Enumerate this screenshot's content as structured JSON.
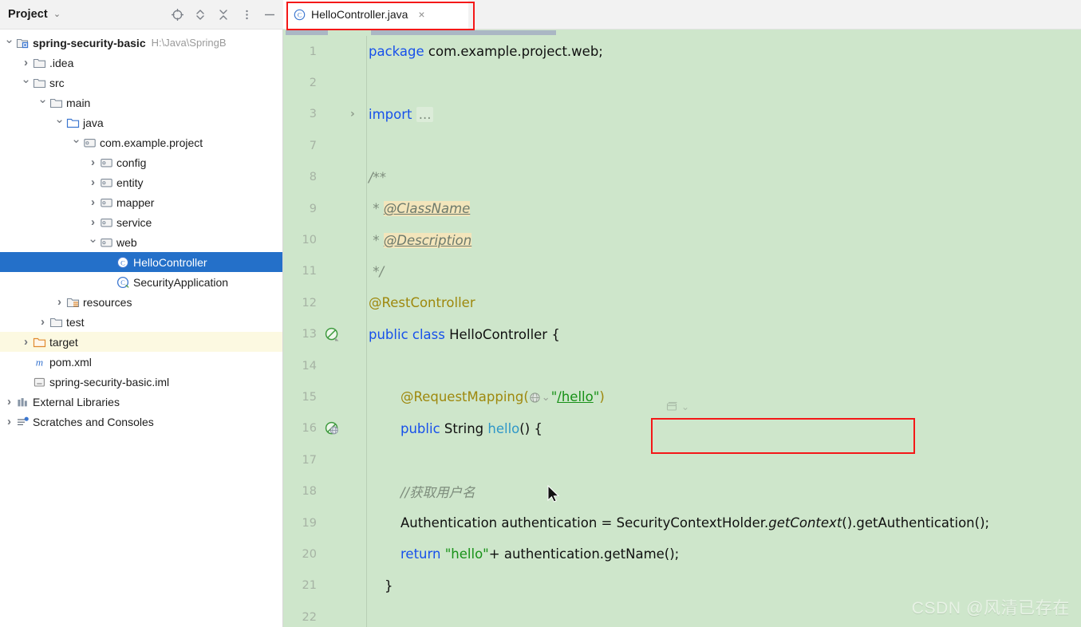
{
  "window": {
    "panel_title": "Project",
    "panel_caret": "⌄"
  },
  "toolbar": {
    "icons": [
      {
        "name": "locate-target-icon",
        "title": "Select Opened File"
      },
      {
        "name": "expand-collapse-icon",
        "title": "Expand / Collapse"
      },
      {
        "name": "collapse-all-icon",
        "title": "Collapse All"
      },
      {
        "name": "more-options-icon",
        "title": "Options"
      },
      {
        "name": "minimize-icon",
        "title": "Hide"
      }
    ]
  },
  "tabs": [
    {
      "label": "HelloController.java",
      "icon": "java-class-icon",
      "close": "×",
      "active": true,
      "annotated": true
    }
  ],
  "annotations": {
    "color": "#f41818",
    "tab_box": "HelloController.java",
    "code_box": "@RequestMapping(\"/hello\")"
  },
  "tree": {
    "items": [
      {
        "depth": 0,
        "arrow": "down",
        "icon": "module-icon",
        "label": "spring-security-basic",
        "bold": true,
        "path": "H:\\Java\\SpringB",
        "state": "normal"
      },
      {
        "depth": 1,
        "arrow": "right",
        "icon": "folder-icon",
        "label": ".idea",
        "bold": false,
        "path": "",
        "state": "normal"
      },
      {
        "depth": 1,
        "arrow": "down",
        "icon": "folder-icon",
        "label": "src",
        "bold": false,
        "path": "",
        "state": "normal"
      },
      {
        "depth": 2,
        "arrow": "down",
        "icon": "folder-icon",
        "label": "main",
        "bold": false,
        "path": "",
        "state": "normal"
      },
      {
        "depth": 3,
        "arrow": "down",
        "icon": "source-root-icon",
        "label": "java",
        "bold": false,
        "path": "",
        "state": "normal"
      },
      {
        "depth": 4,
        "arrow": "down",
        "icon": "package-icon",
        "label": "com.example.project",
        "bold": false,
        "path": "",
        "state": "normal"
      },
      {
        "depth": 5,
        "arrow": "right",
        "icon": "package-icon",
        "label": "config",
        "bold": false,
        "path": "",
        "state": "normal"
      },
      {
        "depth": 5,
        "arrow": "right",
        "icon": "package-icon",
        "label": "entity",
        "bold": false,
        "path": "",
        "state": "normal"
      },
      {
        "depth": 5,
        "arrow": "right",
        "icon": "package-icon",
        "label": "mapper",
        "bold": false,
        "path": "",
        "state": "normal"
      },
      {
        "depth": 5,
        "arrow": "right",
        "icon": "package-icon",
        "label": "service",
        "bold": false,
        "path": "",
        "state": "normal"
      },
      {
        "depth": 5,
        "arrow": "down",
        "icon": "package-icon",
        "label": "web",
        "bold": false,
        "path": "",
        "state": "normal"
      },
      {
        "depth": 6,
        "arrow": "blank",
        "icon": "java-class-icon",
        "label": "HelloController",
        "bold": false,
        "path": "",
        "state": "selected"
      },
      {
        "depth": 6,
        "arrow": "blank",
        "icon": "spring-bean-icon",
        "label": "SecurityApplication",
        "bold": false,
        "path": "",
        "state": "normal"
      },
      {
        "depth": 3,
        "arrow": "right",
        "icon": "resource-root-icon",
        "label": "resources",
        "bold": false,
        "path": "",
        "state": "normal"
      },
      {
        "depth": 2,
        "arrow": "right",
        "icon": "folder-icon",
        "label": "test",
        "bold": false,
        "path": "",
        "state": "normal"
      },
      {
        "depth": 1,
        "arrow": "right",
        "icon": "excluded-folder-icon",
        "label": "target",
        "bold": false,
        "path": "",
        "state": "excluded"
      },
      {
        "depth": 1,
        "arrow": "blank",
        "icon": "maven-icon",
        "label": "pom.xml",
        "bold": false,
        "path": "",
        "state": "normal"
      },
      {
        "depth": 1,
        "arrow": "blank",
        "icon": "iml-icon",
        "label": "spring-security-basic.iml",
        "bold": false,
        "path": "",
        "state": "normal"
      },
      {
        "depth": 0,
        "arrow": "right",
        "icon": "libraries-icon",
        "label": "External Libraries",
        "bold": false,
        "path": "",
        "state": "normal"
      },
      {
        "depth": 0,
        "arrow": "right",
        "icon": "scratches-icon",
        "label": "Scratches and Consoles",
        "bold": false,
        "path": "",
        "state": "normal"
      }
    ]
  },
  "editor": {
    "background": "#cee6cb",
    "gutter_text_color": "#a6b3a4",
    "file": "HelloController.java",
    "lines": [
      {
        "num": "1",
        "gutter_icon": "",
        "fold": "",
        "segments": [
          {
            "t": "package ",
            "c": "kw"
          },
          {
            "t": "com.example.project.web;",
            "c": "plain"
          }
        ]
      },
      {
        "num": "2",
        "gutter_icon": "",
        "fold": "",
        "segments": []
      },
      {
        "num": "3",
        "gutter_icon": "",
        "fold": "right",
        "segments": [
          {
            "t": "import ",
            "c": "kw"
          },
          {
            "t": "...",
            "c": "fold-pl"
          }
        ]
      },
      {
        "num": "7",
        "gutter_icon": "",
        "fold": "",
        "segments": []
      },
      {
        "num": "8",
        "gutter_icon": "",
        "fold": "",
        "segments": [
          {
            "t": "/**",
            "c": "jdoc"
          }
        ]
      },
      {
        "num": "9",
        "gutter_icon": "",
        "fold": "",
        "segments": [
          {
            "t": " * ",
            "c": "jdoc"
          },
          {
            "t": "@ClassName",
            "c": "jdoc-hl"
          }
        ]
      },
      {
        "num": "10",
        "gutter_icon": "",
        "fold": "",
        "segments": [
          {
            "t": " * ",
            "c": "jdoc"
          },
          {
            "t": "@Description",
            "c": "jdoc-hl"
          }
        ]
      },
      {
        "num": "11",
        "gutter_icon": "",
        "fold": "",
        "segments": [
          {
            "t": " */",
            "c": "jdoc"
          }
        ]
      },
      {
        "num": "12",
        "gutter_icon": "",
        "fold": "",
        "segments": [
          {
            "t": "@RestController",
            "c": "anno"
          }
        ]
      },
      {
        "num": "13",
        "gutter_icon": "spring-bean-gutter-icon",
        "fold": "",
        "segments": [
          {
            "t": "public ",
            "c": "kw"
          },
          {
            "t": "class ",
            "c": "kw"
          },
          {
            "t": "HelloController {",
            "c": "plain"
          }
        ]
      },
      {
        "num": "14",
        "gutter_icon": "",
        "fold": "",
        "segments": []
      },
      {
        "num": "15",
        "gutter_icon": "",
        "fold": "",
        "segments": [
          {
            "t": "@RequestMapping",
            "c": "anno"
          },
          {
            "t": "(",
            "c": "anno"
          },
          {
            "t": "GLOBE_CHIP",
            "c": "chip"
          },
          {
            "t": "\"",
            "c": "str"
          },
          {
            "t": "/hello",
            "c": "url"
          },
          {
            "t": "\"",
            "c": "str"
          },
          {
            "t": ")",
            "c": "anno"
          }
        ],
        "indent": 2,
        "annotated": true
      },
      {
        "num": "16",
        "gutter_icon": "spring-mvc-gutter-icon",
        "fold": "",
        "segments": [
          {
            "t": "public ",
            "c": "kw"
          },
          {
            "t": "String ",
            "c": "plain"
          },
          {
            "t": "hello",
            "c": "meth"
          },
          {
            "t": "() {",
            "c": "plain"
          }
        ],
        "indent": 2
      },
      {
        "num": "17",
        "gutter_icon": "",
        "fold": "",
        "segments": [],
        "indent": 2
      },
      {
        "num": "18",
        "gutter_icon": "",
        "fold": "",
        "segments": [
          {
            "t": "//获取用户名",
            "c": "cmt"
          }
        ],
        "indent": 2
      },
      {
        "num": "19",
        "gutter_icon": "",
        "fold": "",
        "segments": [
          {
            "t": "Authentication authentication = SecurityContextHolder.",
            "c": "plain"
          },
          {
            "t": "getContext",
            "c": "static"
          },
          {
            "t": "().getAuthentication();",
            "c": "plain"
          }
        ],
        "indent": 2
      },
      {
        "num": "20",
        "gutter_icon": "",
        "fold": "",
        "segments": [
          {
            "t": "return ",
            "c": "kw"
          },
          {
            "t": "\"hello\"",
            "c": "str"
          },
          {
            "t": "+ authentication.getName();",
            "c": "plain"
          }
        ],
        "indent": 2
      },
      {
        "num": "21",
        "gutter_icon": "",
        "fold": "",
        "segments": [
          {
            "t": "}",
            "c": "plain"
          }
        ],
        "indent": 1
      },
      {
        "num": "22",
        "gutter_icon": "",
        "fold": "",
        "segments": []
      }
    ]
  },
  "watermark": {
    "text": "CSDN @风清已存在"
  }
}
